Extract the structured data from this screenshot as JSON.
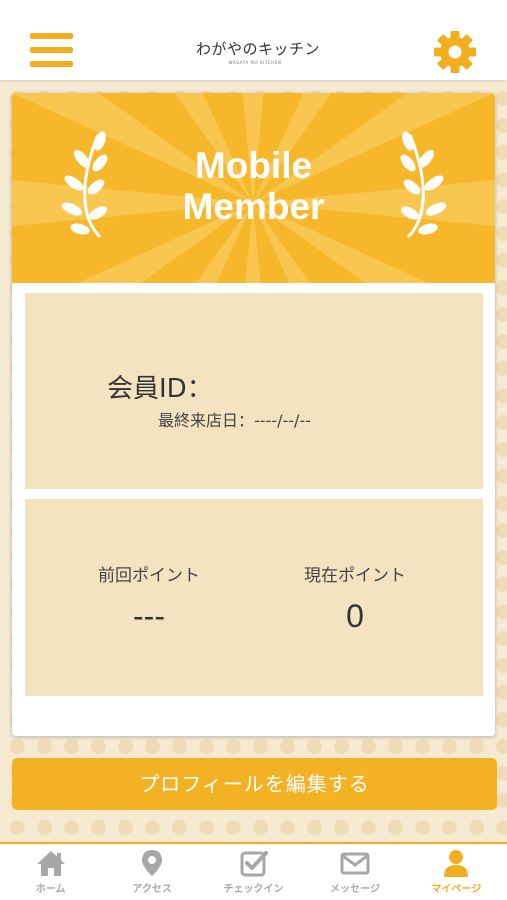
{
  "colors": {
    "accent": "#f2ae1e",
    "banner": "#f7b72a",
    "panel": "#f3e3c1",
    "inactive_tab": "#a7a7a7"
  },
  "header": {
    "menu_icon": "hamburger-menu-icon",
    "logo_text": "わがやのキッチン",
    "logo_subtext": "WAGAYA NO KITCHEN",
    "settings_icon": "gear-icon"
  },
  "member_card": {
    "banner_title_line1": "Mobile",
    "banner_title_line2": "Member",
    "member_id_label": "会員ID：",
    "member_id_value": "",
    "last_visit_label": "最終来店日：",
    "last_visit_value": "----/--/--",
    "previous_points_label": "前回ポイント",
    "previous_points_value": "---",
    "current_points_label": "現在ポイント",
    "current_points_value": "0"
  },
  "edit_profile_button": "プロフィールを編集する",
  "tabs": [
    {
      "label": "ホーム",
      "icon": "home-icon",
      "active": false
    },
    {
      "label": "アクセス",
      "icon": "map-pin-icon",
      "active": false
    },
    {
      "label": "チェックイン",
      "icon": "checkbox-icon",
      "active": false
    },
    {
      "label": "メッセージ",
      "icon": "envelope-icon",
      "active": false
    },
    {
      "label": "マイページ",
      "icon": "user-icon",
      "active": true
    }
  ]
}
